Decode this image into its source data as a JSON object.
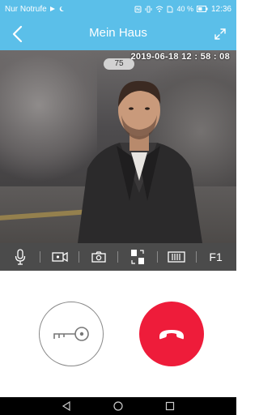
{
  "status_bar": {
    "carrier": "Nur Notrufe",
    "icons": [
      "play-icon",
      "moon-icon",
      "nfc-icon",
      "vibrate-icon",
      "wifi-icon",
      "sim-icon",
      "battery-icon"
    ],
    "battery": "40 %",
    "time": "12:36"
  },
  "app_bar": {
    "title": "Mein Haus",
    "back_icon": "chevron-left-icon",
    "fullscreen_icon": "expand-icon"
  },
  "video": {
    "timestamp": "2019-06-18 12 : 58 : 08",
    "counter": "75"
  },
  "toolbar": {
    "items": [
      {
        "icon": "microphone-icon"
      },
      {
        "icon": "video-record-icon"
      },
      {
        "icon": "camera-icon"
      },
      {
        "icon": "resolution-icon"
      },
      {
        "icon": "panel-icon"
      },
      {
        "label": "F1"
      }
    ]
  },
  "actions": {
    "unlock_icon": "key-icon",
    "hangup_icon": "phone-hangup-icon",
    "hangup_color": "#ee1c3a"
  },
  "colors": {
    "accent": "#5bbfe9",
    "toolbar": "#4b4b4b"
  },
  "nav_bar": {
    "icons": [
      "back-triangle-icon",
      "home-circle-icon",
      "recents-square-icon"
    ]
  }
}
